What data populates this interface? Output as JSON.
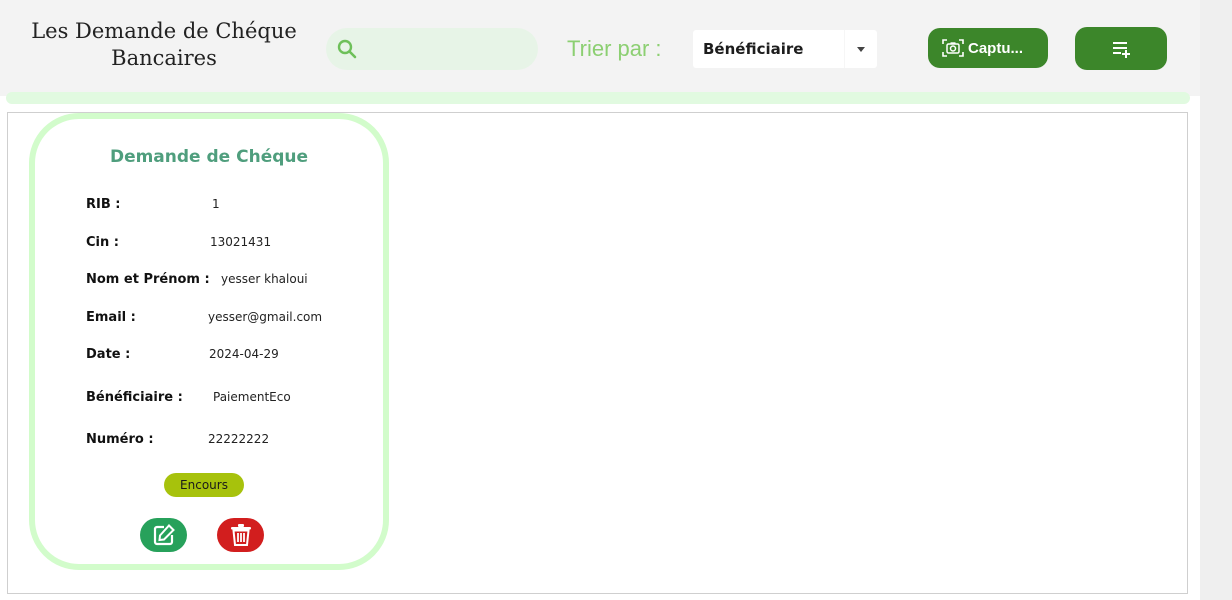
{
  "header": {
    "title": "Les Demande de Chéque Bancaires",
    "search": {
      "placeholder": "",
      "value": ""
    },
    "sort_label": "Trier par :",
    "sort_select": {
      "selected": "Bénéficiaire"
    },
    "capture_label": "Captu...",
    "add_icon": "playlist-add-icon",
    "search_icon": "search-icon",
    "camera_icon": "camera-icon"
  },
  "card": {
    "title": "Demande de Chéque",
    "fields": [
      {
        "label": "RIB :",
        "value": "1"
      },
      {
        "label": "Cin :",
        "value": "13021431"
      },
      {
        "label": "Nom et Prénom :",
        "value": "yesser khaloui"
      },
      {
        "label": "Email :",
        "value": "yesser@gmail.com"
      },
      {
        "label": "Date  :",
        "value": "2024-04-29"
      },
      {
        "label": "Bénéficiaire :",
        "value": "PaiementEco"
      },
      {
        "label": "Numéro  :",
        "value": "22222222"
      }
    ],
    "status": "Encours",
    "edit_icon": "edit-icon",
    "delete_icon": "trash-icon"
  },
  "colors": {
    "accent_green": "#3c862a",
    "title_green": "#4f9e7d",
    "card_border": "#d2fccb",
    "status_badge": "#a7c20c",
    "delete_red": "#d21e1e",
    "edit_green": "#27a15b"
  }
}
